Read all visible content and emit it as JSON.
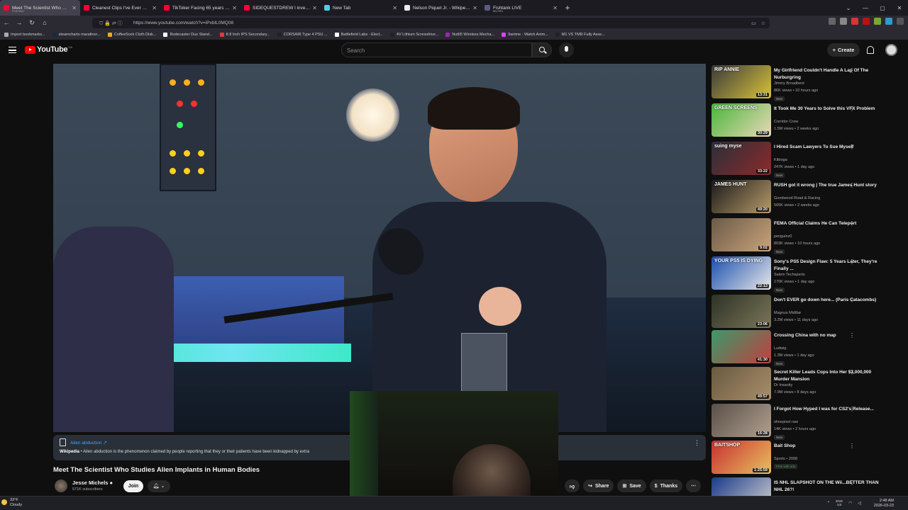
{
  "browser": {
    "tabs": [
      {
        "title": "Meet The Scientist Who Studie",
        "subtitle": "PLAYING",
        "color": "#ff0033",
        "active": true
      },
      {
        "title": "Cleanest Clips I've Ever Hit... (Ji",
        "color": "#ff0033"
      },
      {
        "title": "TikToker Facing 65 years in Pris",
        "color": "#ff0033"
      },
      {
        "title": "SIDEQUESTDREW l investigate",
        "color": "#ff0033"
      },
      {
        "title": "New Tab",
        "color": "#4dd0e1"
      },
      {
        "title": "Nelson Piquet Jr. - Wikipedia",
        "color": "#eeeeee"
      },
      {
        "title": "Fishtank LIVE",
        "subtitle": "MUTED",
        "color": "#5a5a8a"
      }
    ],
    "new_tab_label": "+",
    "url": "https://www.youtube.com/watch?v=iPxbIL0MQ08",
    "bookmarks": [
      {
        "label": "Import bookmarks...",
        "color": "#aaaaaa"
      },
      {
        "label": "steamcharts marathon...",
        "color": "#1b2838"
      },
      {
        "label": "CoffeeSock Cloth Disk...",
        "color": "#f5a623"
      },
      {
        "label": "Rodecaster Duo Stand...",
        "color": "#ffffff"
      },
      {
        "label": "8.8 Inch IPS Secondary...",
        "color": "#e53935"
      },
      {
        "label": "CORSAIR Type 4 PSU ...",
        "color": "#222222"
      },
      {
        "label": "Battlefield Labs - Elect...",
        "color": "#ffffff"
      },
      {
        "label": "4V Lithium Screwdrive...",
        "color": "#222222"
      },
      {
        "label": "Nut65 Wireless Mecha...",
        "color": "#9c27b0"
      },
      {
        "label": "9anime - Watch Anim...",
        "color": "#e040fb"
      },
      {
        "label": "M1 VS TMR Fully Asse...",
        "color": "#222222"
      }
    ]
  },
  "youtube": {
    "logo": "YouTube",
    "country": "CA",
    "search_placeholder": "Search",
    "create_label": "Create",
    "accent": "#ff0000"
  },
  "video": {
    "title": "Meet The Scientist Who Studies Alien Implants in Human Bodies",
    "info_panel": {
      "topic": "Alien abduction",
      "source": "Wikipedia",
      "description": "• Alien abduction is the phenomenon claimed by people reporting that they or their patients have been kidnapped by extra"
    },
    "channel": {
      "name": "Jesse Michels",
      "subscribers": "571K subscribers"
    },
    "join_label": "Join",
    "actions": [
      {
        "label": "",
        "icon": "dislike-icon"
      },
      {
        "label": "Share",
        "icon": "share-icon"
      },
      {
        "label": "Save",
        "icon": "save-icon"
      },
      {
        "label": "Thanks",
        "icon": "thanks-icon"
      },
      {
        "label": "",
        "icon": "more-icon"
      }
    ]
  },
  "recommendations": [
    {
      "title": "My Girlfriend Couldn't Handle A Lap Of The Nurburgring",
      "channel": "Jimmy Broadbent",
      "meta": "86K views • 10 hours ago",
      "badge": "New",
      "duration": "13:31",
      "thumb_text": "RIP ANNIE",
      "c1": "#3a3a3a",
      "c2": "#d8c23a"
    },
    {
      "title": "It Took Me 30 Years to Solve this VFX Problem",
      "channel": "Corridor Crew",
      "meta": "1.5M views • 2 weeks ago",
      "badge": "",
      "duration": "30:29",
      "thumb_text": "GREEN SCREENS",
      "c1": "#49b63a",
      "c2": "#e9d8b8"
    },
    {
      "title": "I Hired Scam Lawyers To Sue Myself",
      "channel": "Kitboga",
      "meta": "247K views • 1 day ago",
      "badge": "New",
      "duration": "33:22",
      "thumb_text": "suing myse",
      "c1": "#2a2f3a",
      "c2": "#8c2a2a"
    },
    {
      "title": "RUSH got it wrong | The true James Hunt story",
      "channel": "Goodwood Road & Racing",
      "meta": "565K views • 2 weeks ago",
      "badge": "",
      "duration": "49:20",
      "thumb_text": "JAMES HUNT",
      "c1": "#1a1a1a",
      "c2": "#b79a6a"
    },
    {
      "title": "FEMA Official Claims He Can Teleport",
      "channel": "penguinz0",
      "meta": "803K views • 10 hours ago",
      "badge": "New",
      "duration": "9:02",
      "thumb_text": "",
      "c1": "#6b5a48",
      "c2": "#c9a47a"
    },
    {
      "title": "Sony's PS5 Design Flaw: 5 Years Later, They're Finally ...",
      "channel": "Salem Techsperts",
      "meta": "176K views • 1 day ago",
      "badge": "New",
      "duration": "22:13",
      "thumb_text": "YOUR PS5 IS DYING",
      "c1": "#1b4fb0",
      "c2": "#e8e8e8"
    },
    {
      "title": "Don't EVER go down here... (Paris Catacombs)",
      "channel": "Magnus Midtbø",
      "meta": "3.2M views • 11 days ago",
      "badge": "",
      "duration": "23:06",
      "thumb_text": "",
      "c1": "#2e3326",
      "c2": "#7a7558"
    },
    {
      "title": "Crossing China with no map",
      "channel": "Ludwig",
      "meta": "1.3M views • 1 day ago",
      "badge": "New",
      "duration": "41:30",
      "thumb_text": "",
      "c1": "#3a9a6a",
      "c2": "#c04040"
    },
    {
      "title": "Secret Killer Leads Cops Into Her $3,000,000 Murder Mansion",
      "channel": "Dr Insanity",
      "meta": "7.9M views • 8 days ago",
      "badge": "",
      "duration": "49:57",
      "thumb_text": "",
      "c1": "#6a5a40",
      "c2": "#a88e6a"
    },
    {
      "title": "I Forgot How Hyped I was for CS2's Release...",
      "channel": "ohnepixel raw",
      "meta": "14K views • 2 hours ago",
      "badge": "New",
      "duration": "16:28",
      "thumb_text": "",
      "c1": "#5a5048",
      "c2": "#b0a090"
    },
    {
      "title": "Bait Shop",
      "channel": "Sports • 2008",
      "meta": "",
      "badge": "Free with ads",
      "duration": "1:25:59",
      "thumb_text": "BAITSHOP",
      "c1": "#c83030",
      "c2": "#e8c060"
    },
    {
      "title": "IS NHL SLAPSHOT ON THE Wii...BETTER THAN NHL 26?!",
      "channel": "",
      "meta": "",
      "badge": "",
      "duration": "",
      "thumb_text": "",
      "c1": "#1a3a8a",
      "c2": "#d0d0d0"
    }
  ],
  "taskbar": {
    "temperature": "33°F",
    "condition": "Cloudy",
    "lang_top": "ENG",
    "lang_bottom": "US",
    "time": "2:48 AM",
    "date": "2026-03-23"
  }
}
